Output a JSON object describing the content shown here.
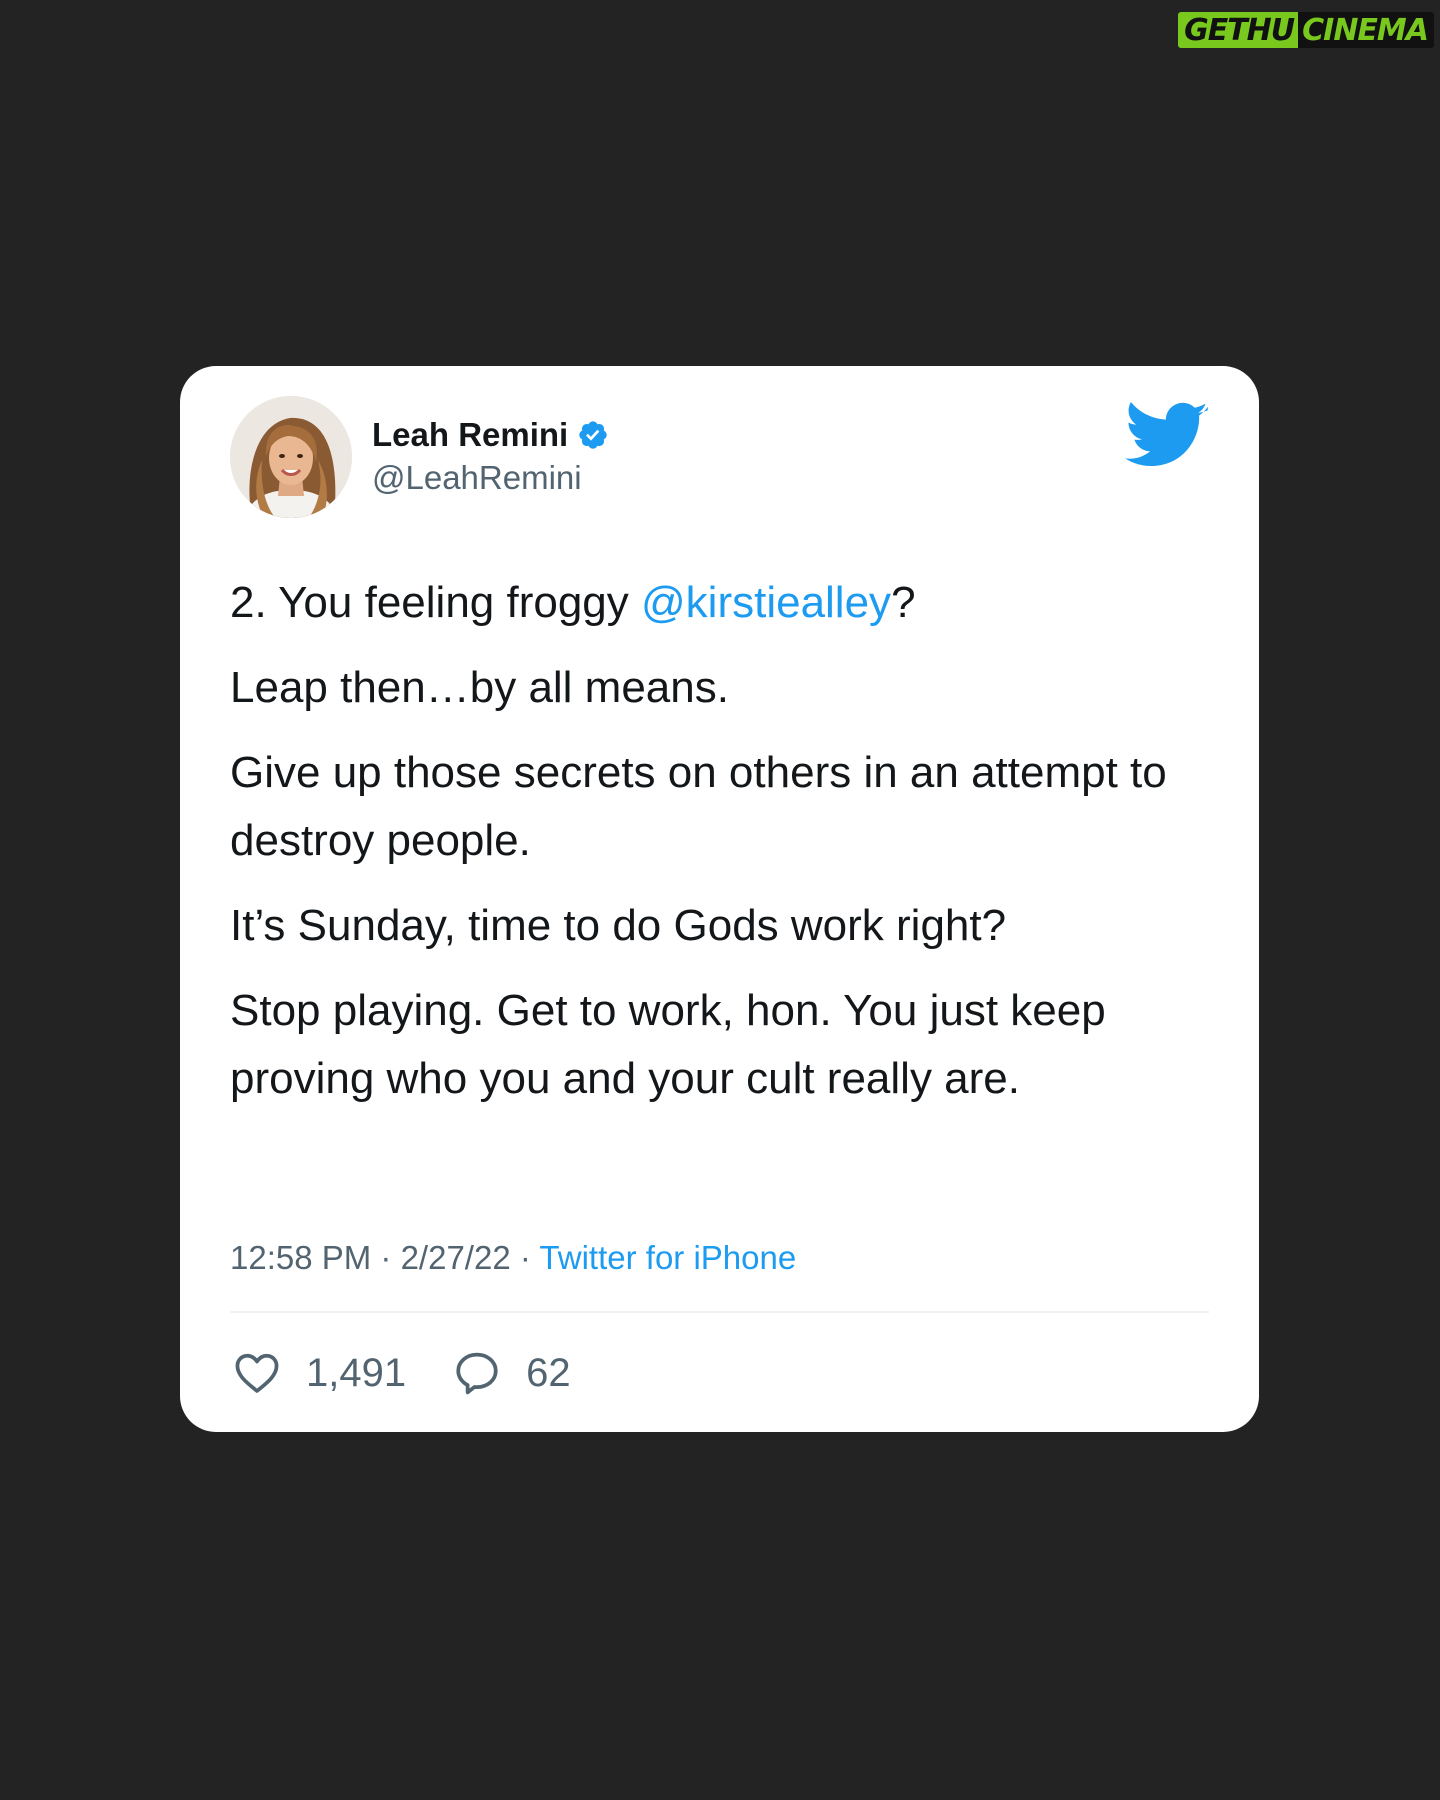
{
  "watermark": {
    "left": "GETHU",
    "right": "CINEMA",
    "color": "#78c81e"
  },
  "tweet": {
    "author": {
      "display_name": "Leah Remini",
      "handle": "@LeahRemini",
      "verified": true,
      "avatar_icon": "avatar-photo"
    },
    "brand_icon": "twitter-bird-icon",
    "body": {
      "line1_prefix": "2. You feeling froggy ",
      "line1_mention": "@kirstiealley",
      "line1_suffix": "?",
      "p2": "Leap then…by all means.",
      "p3": "Give up those secrets on others in an attempt to destroy people.",
      "p4": "It’s Sunday, time to do Gods work right?",
      "p5": "Stop playing. Get to work, hon. You just keep proving who you and your cult really are."
    },
    "meta": {
      "time": "12:58 PM",
      "separator": " · ",
      "date": "2/27/22",
      "source": "Twitter for iPhone"
    },
    "stats": {
      "likes": "1,491",
      "replies": "62"
    }
  },
  "colors": {
    "background": "#232323",
    "card": "#ffffff",
    "accent": "#1d9bf0",
    "text": "#14171a",
    "muted": "#536471"
  }
}
